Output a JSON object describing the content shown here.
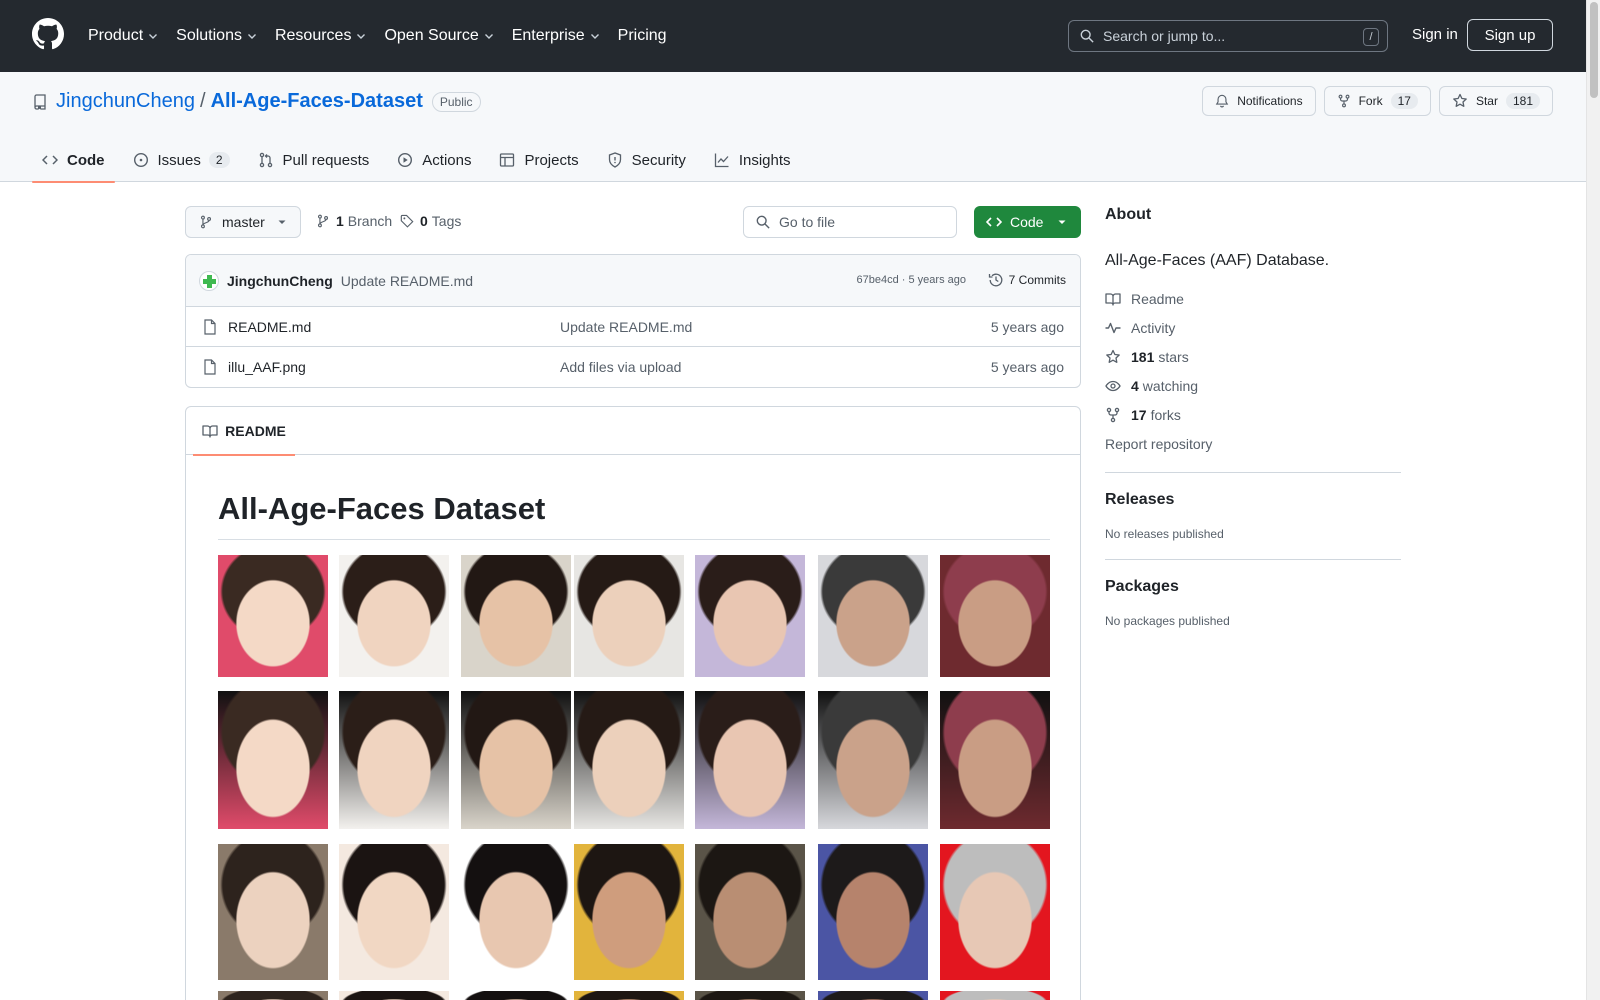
{
  "header": {
    "nav": [
      "Product",
      "Solutions",
      "Resources",
      "Open Source",
      "Enterprise",
      "Pricing"
    ],
    "search_placeholder": "Search or jump to...",
    "search_shortcut": "/",
    "sign_in": "Sign in",
    "sign_up": "Sign up"
  },
  "repo": {
    "owner": "JingchunCheng",
    "separator": "/",
    "name": "All-Age-Faces-Dataset",
    "visibility": "Public",
    "notifications_label": "Notifications",
    "fork_label": "Fork",
    "fork_count": "17",
    "star_label": "Star",
    "star_count": "181"
  },
  "tabs": [
    {
      "label": "Code",
      "icon": "code-icon",
      "selected": true
    },
    {
      "label": "Issues",
      "icon": "issue-icon",
      "count": "2"
    },
    {
      "label": "Pull requests",
      "icon": "pull-request-icon"
    },
    {
      "label": "Actions",
      "icon": "play-icon"
    },
    {
      "label": "Projects",
      "icon": "table-icon"
    },
    {
      "label": "Security",
      "icon": "shield-icon"
    },
    {
      "label": "Insights",
      "icon": "graph-icon"
    }
  ],
  "file_nav": {
    "branch": "master",
    "branch_count": "1",
    "branch_label": "Branch",
    "tag_count": "0",
    "tag_label": "Tags",
    "goto_placeholder": "Go to file",
    "code_button": "Code"
  },
  "latest_commit": {
    "author": "JingchunCheng",
    "message": "Update README.md",
    "meta": "67be4cd · 5 years ago",
    "commits_label": "7 Commits"
  },
  "files": [
    {
      "name": "README.md",
      "commit": "Update README.md",
      "age": "5 years ago"
    },
    {
      "name": "illu_AAF.png",
      "commit": "Add files via upload",
      "age": "5 years ago"
    }
  ],
  "readme": {
    "tab_label": "README",
    "title": "All-Age-Faces Dataset"
  },
  "sidebar": {
    "about_title": "About",
    "description": "All-Age-Faces (AAF) Database.",
    "links": [
      {
        "icon": "book-icon",
        "label": "Readme"
      },
      {
        "icon": "pulse-icon",
        "label": "Activity"
      },
      {
        "icon": "star-icon",
        "count": "181",
        "label": "stars"
      },
      {
        "icon": "eye-icon",
        "count": "4",
        "label": "watching"
      },
      {
        "icon": "fork-icon",
        "count": "17",
        "label": "forks"
      }
    ],
    "report": "Report repository",
    "releases_title": "Releases",
    "releases_empty": "No releases published",
    "packages_title": "Packages",
    "packages_empty": "No packages published"
  }
}
